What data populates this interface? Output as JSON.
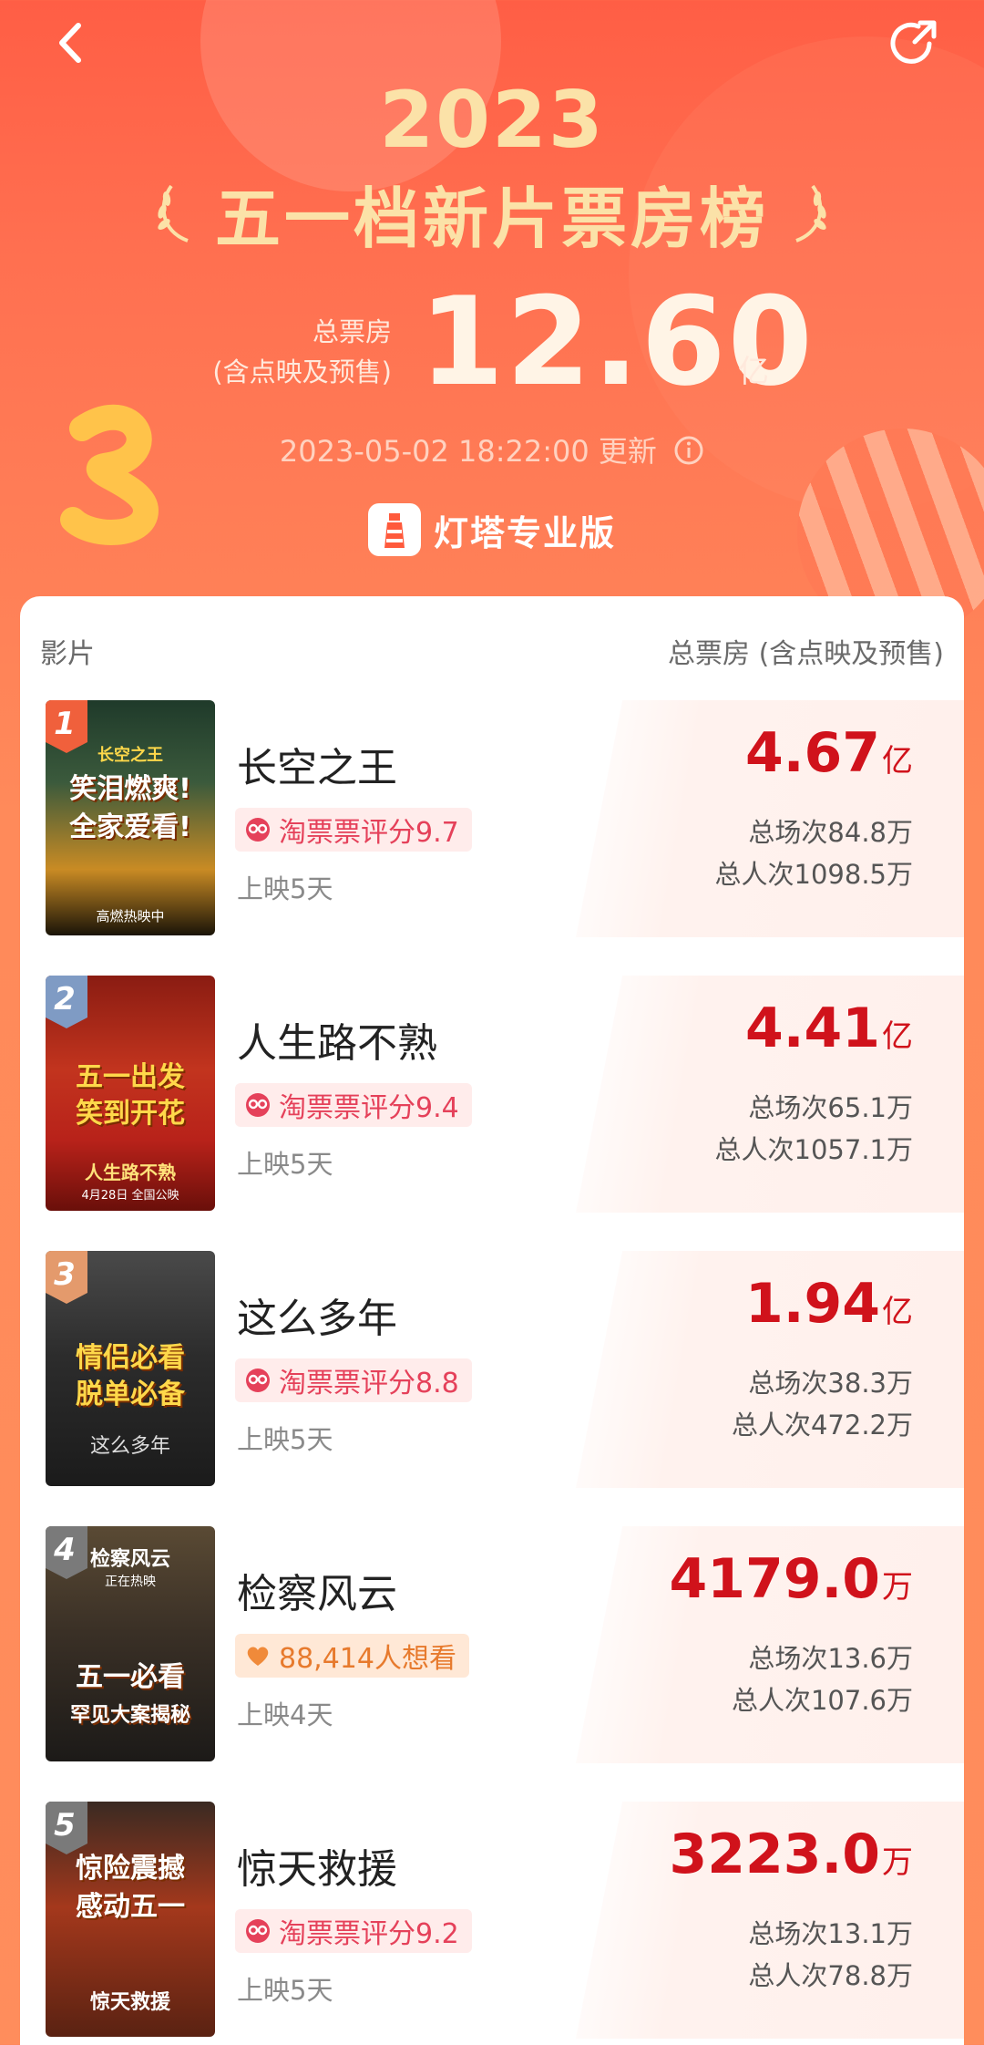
{
  "header": {
    "year": "2023",
    "title": "五一档新片票房榜",
    "gross_label_line1": "总票房",
    "gross_label_line2": "(含点映及预售)",
    "gross_value": "12.60",
    "gross_unit": "亿",
    "update_text": "2023-05-02 18:22:00 更新",
    "brand_name": "灯塔专业版"
  },
  "list": {
    "col_left": "影片",
    "col_right": "总票房 (含点映及预售)",
    "rows": [
      {
        "rank": "1",
        "title": "长空之王",
        "tag_type": "rating",
        "tag_text": "淘票票评分9.7",
        "days": "上映5天",
        "gross": "4.67",
        "unit": "亿",
        "shows": "总场次84.8万",
        "admissions": "总人次1098.5万",
        "poster_title": "长空之王",
        "poster_slogan1": "笑泪燃爽!",
        "poster_slogan2": "全家爱看!",
        "poster_foot": "高燃热映中"
      },
      {
        "rank": "2",
        "title": "人生路不熟",
        "tag_type": "rating",
        "tag_text": "淘票票评分9.4",
        "days": "上映5天",
        "gross": "4.41",
        "unit": "亿",
        "shows": "总场次65.1万",
        "admissions": "总人次1057.1万",
        "poster_title": "人生路不熟",
        "poster_slogan1": "五一出发",
        "poster_slogan2": "笑到开花",
        "poster_foot": "4月28日 全国公映"
      },
      {
        "rank": "3",
        "title": "这么多年",
        "tag_type": "rating",
        "tag_text": "淘票票评分8.8",
        "days": "上映5天",
        "gross": "1.94",
        "unit": "亿",
        "shows": "总场次38.3万",
        "admissions": "总人次472.2万",
        "poster_title": "这么多年",
        "poster_slogan1": "情侣必看",
        "poster_slogan2": "脱单必备",
        "poster_foot": ""
      },
      {
        "rank": "4",
        "title": "检察风云",
        "tag_type": "want",
        "tag_text": "88,414人想看",
        "days": "上映4天",
        "gross": "4179.0",
        "unit": "万",
        "shows": "总场次13.6万",
        "admissions": "总人次107.6万",
        "poster_title": "检察风云",
        "poster_slogan1": "五一必看",
        "poster_slogan2": "罕见大案揭秘",
        "poster_foot": "正在热映"
      },
      {
        "rank": "5",
        "title": "惊天救援",
        "tag_type": "rating",
        "tag_text": "淘票票评分9.2",
        "days": "上映5天",
        "gross": "3223.0",
        "unit": "万",
        "shows": "总场次13.1万",
        "admissions": "总人次78.8万",
        "poster_title": "惊天救援",
        "poster_slogan1": "惊险震撼",
        "poster_slogan2": "感动五一",
        "poster_foot": ""
      }
    ]
  },
  "colors": {
    "gross_red": "#d0121b",
    "rating_pink": "#e5415a",
    "want_orange": "#e77a2d",
    "header_gold": "#fbe2a8"
  },
  "icons": [
    "back-arrow-icon",
    "share-refresh-icon",
    "laurel-icon",
    "info-icon",
    "lighthouse-logo-icon",
    "taopiaopiao-icon",
    "heart-icon"
  ]
}
